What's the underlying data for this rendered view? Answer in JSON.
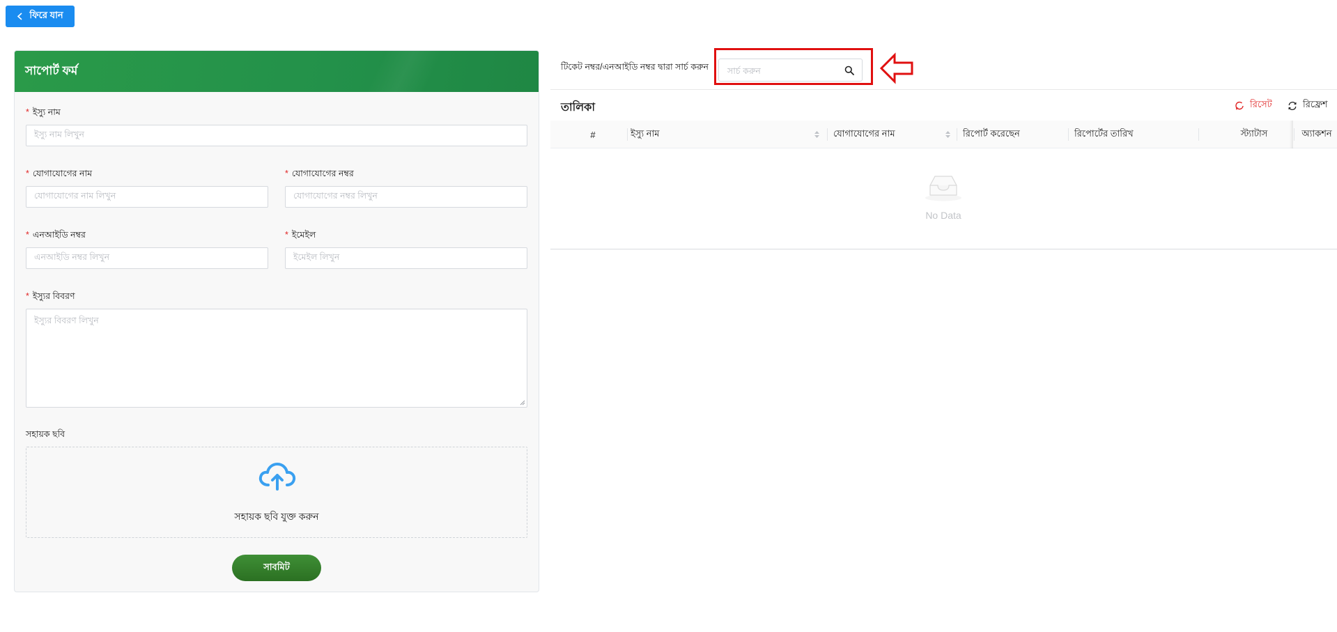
{
  "back_button": {
    "label": "ফিরে যান",
    "icon": "chevron-left-icon"
  },
  "form": {
    "title": "সাপোর্ট ফর্ম",
    "issue_name": {
      "label": "ইস্যু নাম",
      "placeholder": "ইস্যু নাম লিখুন",
      "required": true
    },
    "contact_name": {
      "label": "যোগাযোগের নাম",
      "placeholder": "যোগাযোগের নাম লিখুন",
      "required": true
    },
    "contact_number": {
      "label": "যোগাযোগের নম্বর",
      "placeholder": "যোগাযোগের নম্বর লিখুন",
      "required": true
    },
    "nid_number": {
      "label": "এনআইডি নম্বর",
      "placeholder": "এনআইডি নম্বর লিখুন",
      "required": true
    },
    "email": {
      "label": "ইমেইল",
      "placeholder": "ইমেইল লিখুন",
      "required": true
    },
    "issue_description": {
      "label": "ইস্যুর বিবরণ",
      "placeholder": "ইস্যুর বিবরণ লিখুন",
      "required": true
    },
    "attachment": {
      "label": "সহায়ক ছবি",
      "upload_text": "সহায়ক ছবি যুক্ত করুন",
      "icon": "cloud-upload-icon"
    },
    "submit_label": "সাবমিট",
    "required_mark": "*"
  },
  "search": {
    "label": "টিকেট নম্বর/এনআইডি নম্বর দ্বারা সার্চ করুন",
    "placeholder": "সার্চ করুন",
    "icon": "search-icon",
    "highlight_color": "#e01010"
  },
  "table": {
    "title": "তালিকা",
    "reset_label": "রিসেট",
    "refresh_label": "রিফ্রেশ",
    "columns": [
      "#",
      "ইস্যু নাম",
      "যোগাযোগের নাম",
      "রিপোর্ট করেছেন",
      "রিপোর্টের তারিখ",
      "স্ট্যাটাস",
      "অ্যাকশন"
    ],
    "rows": [],
    "empty_text": "No Data"
  },
  "colors": {
    "primary_blue": "#1a8cf0",
    "header_green": "#2a9a49",
    "submit_green": "#2b7022",
    "required_red": "#e02424",
    "upload_icon_blue": "#3aa0f0"
  }
}
